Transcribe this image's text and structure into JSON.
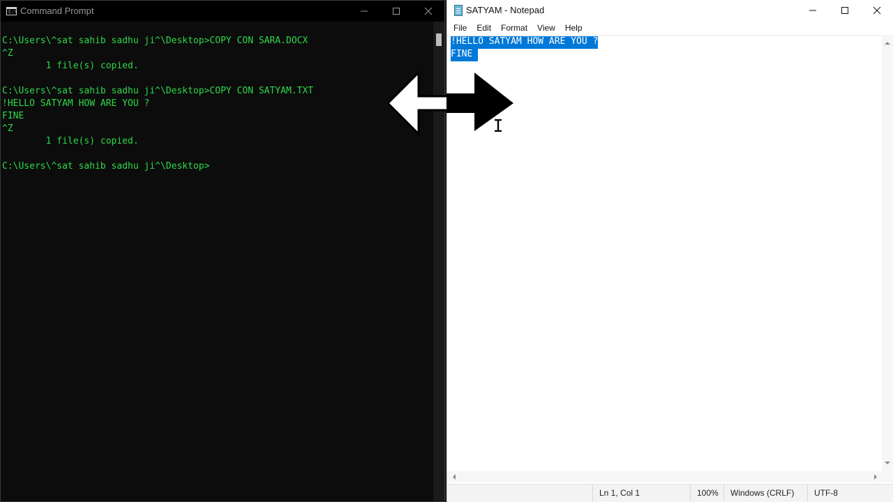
{
  "cmd": {
    "title": "Command Prompt",
    "icon": "terminal-icon",
    "icon_text": "C:\\",
    "lines": [
      "C:\\Users\\^sat sahib sadhu ji^\\Desktop>COPY CON SARA.DOCX",
      "^Z",
      "        1 file(s) copied.",
      "",
      "C:\\Users\\^sat sahib sadhu ji^\\Desktop>COPY CON SATYAM.TXT",
      "!HELLO SATYAM HOW ARE YOU ?",
      "FINE",
      "^Z",
      "        1 file(s) copied.",
      "",
      "C:\\Users\\^sat sahib sadhu ji^\\Desktop>"
    ],
    "text_color": "#2fd84a",
    "background": "#0c0c0c"
  },
  "notepad": {
    "title": "SATYAM - Notepad",
    "icon": "notepad-icon",
    "menu": [
      "File",
      "Edit",
      "Format",
      "View",
      "Help"
    ],
    "content_lines": [
      "!HELLO SATYAM HOW ARE YOU ?",
      "FINE "
    ],
    "selection_color": "#0078d7",
    "status": {
      "position": "Ln 1, Col 1",
      "zoom": "100%",
      "line_ending": "Windows (CRLF)",
      "encoding": "UTF-8"
    }
  },
  "overlay": {
    "icon": "double-arrow-icon",
    "left_color": "#ffffff",
    "right_color": "#000000"
  }
}
